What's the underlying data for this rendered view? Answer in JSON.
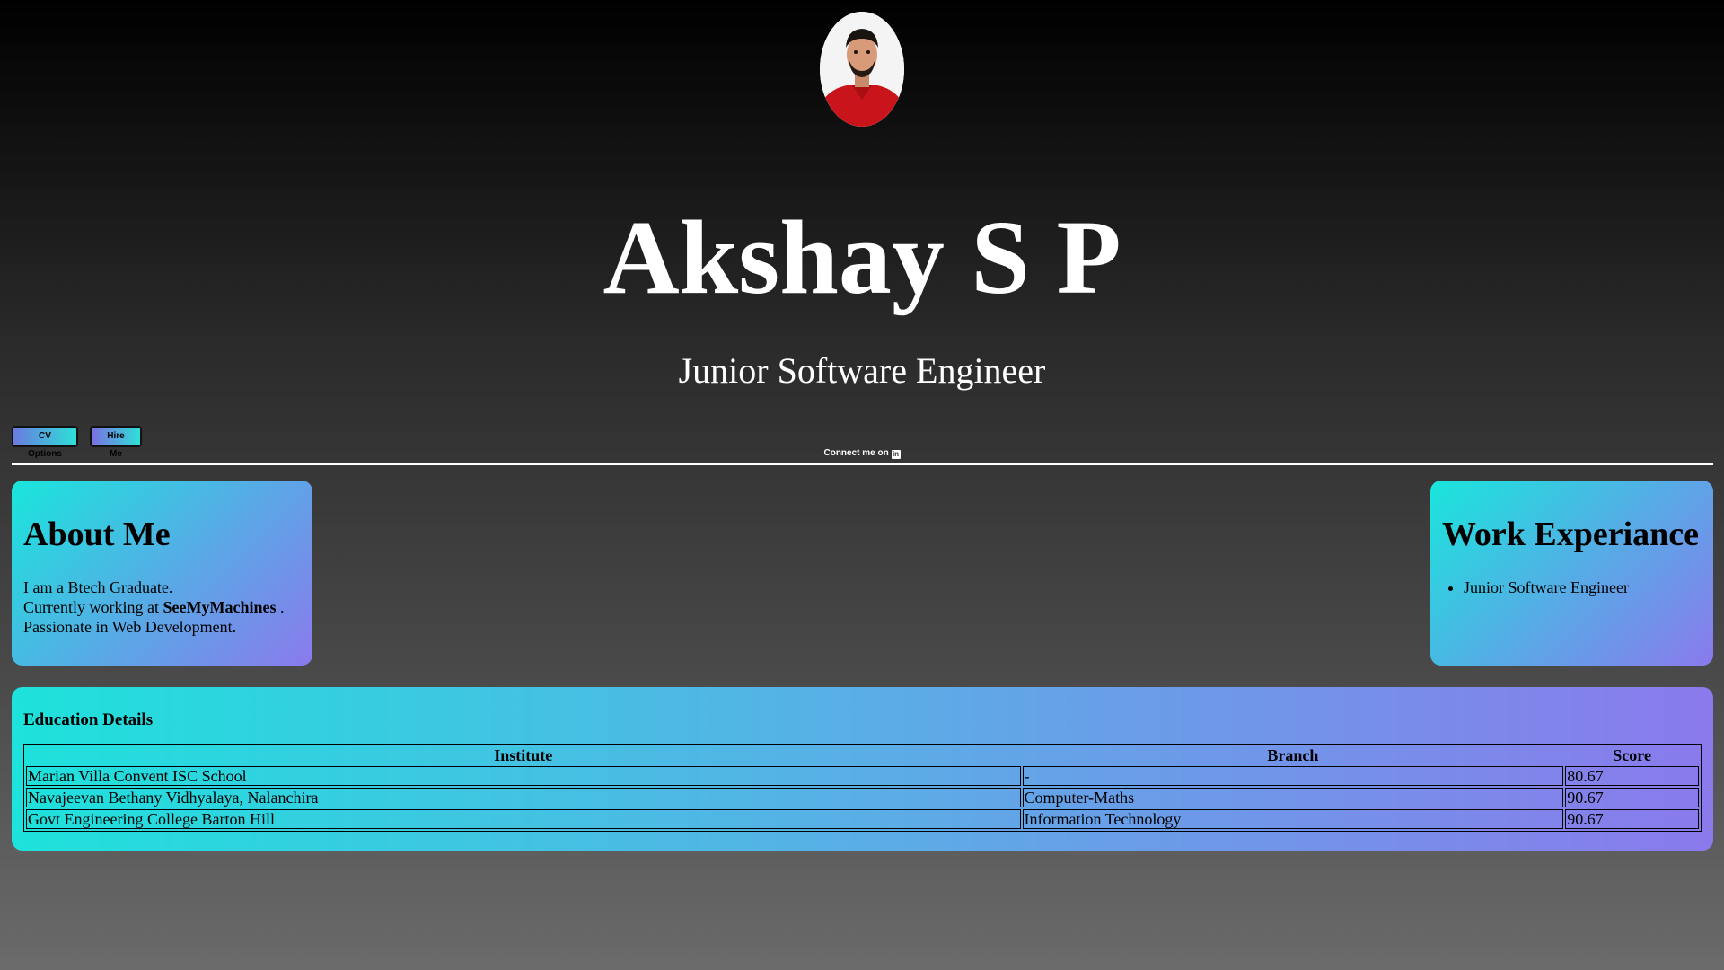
{
  "profile": {
    "photo_icon": "profile-photo",
    "name": "Akshay S P",
    "role": "Junior Software Engineer"
  },
  "actions": {
    "cv_label": "CV Options",
    "hire_label": "Hire Me",
    "connect_label": "Connect me on",
    "connect_icon": "linkedin-icon"
  },
  "about": {
    "title": "About Me",
    "line1": "I am a Btech Graduate.",
    "line2_prefix": "Currently working at",
    "company": "SeeMyMachines",
    "line2_suffix": ".",
    "line3": "Passionate in Web Development."
  },
  "work": {
    "title": "Work Experiance",
    "items": [
      "Junior Software Engineer"
    ]
  },
  "education": {
    "title": "Education Details",
    "headers": [
      "Institute",
      "Branch",
      "Score"
    ],
    "rows": [
      [
        "Marian Villa Convent ISC School",
        "-",
        "80.67"
      ],
      [
        "Navajeevan Bethany Vidhyalaya, Nalanchira",
        "Computer-Maths",
        "90.67"
      ],
      [
        "Govt Engineering College Barton Hill",
        "Information Technology",
        "90.67"
      ]
    ]
  },
  "colors": {
    "card_gradient_start": "#19e6dc",
    "card_gradient_end": "#8a7aec",
    "page_top": "#000000",
    "page_bottom": "#6b6b6b"
  }
}
